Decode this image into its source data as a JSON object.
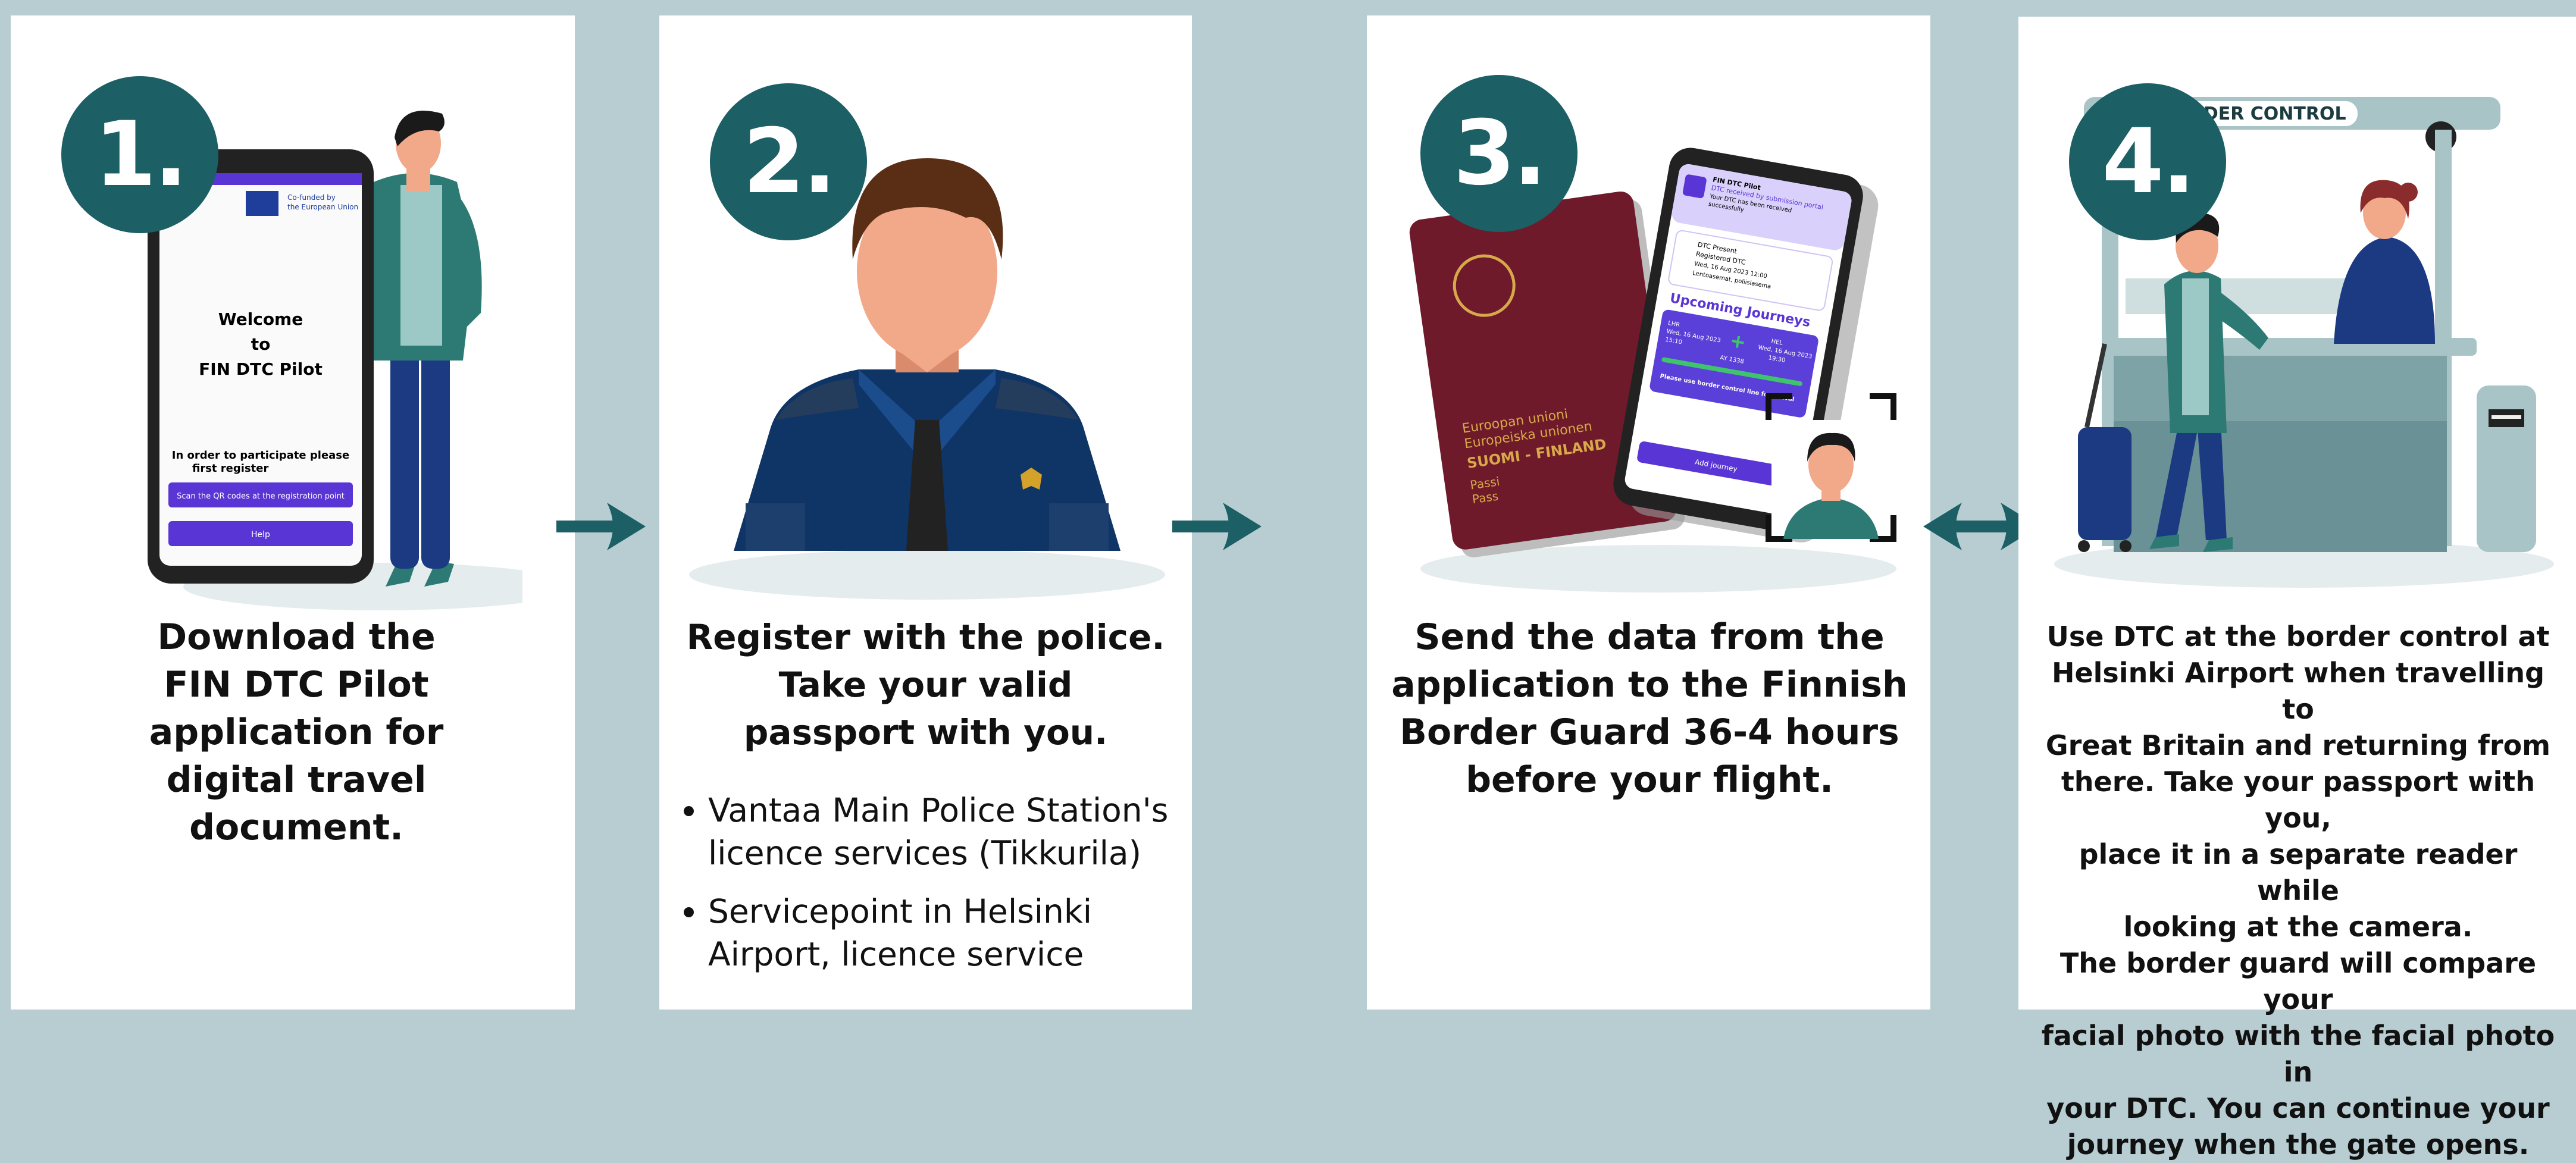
{
  "steps": [
    {
      "number": "1.",
      "caption": [
        "Download the",
        "FIN DTC Pilot",
        "application for",
        "digital travel",
        "document."
      ],
      "phone": {
        "cofunded": [
          "Co-funded by",
          "the European Union"
        ],
        "welcome": [
          "Welcome",
          "to",
          "FIN DTC Pilot"
        ],
        "register": [
          "In order to participate please",
          "first register"
        ],
        "button1": "Scan the QR codes at the registration point",
        "button2": "Help"
      }
    },
    {
      "number": "2.",
      "caption": [
        "Register with the police.",
        "Take your valid",
        "passport with you."
      ],
      "bullets": [
        [
          "Vantaa Main Police Station's",
          "licence services (Tikkurila)"
        ],
        [
          "Servicepoint in Helsinki",
          "Airport, licence service"
        ]
      ]
    },
    {
      "number": "3.",
      "caption": [
        "Send the data from the",
        "application to the Finnish",
        "Border Guard 36-4 hours",
        "before your flight."
      ],
      "passport": [
        "Euroopan unioni",
        "Europeiska unionen",
        "SUOMI - FINLAND",
        "Passi",
        "Pass"
      ],
      "phone": {
        "header": [
          "FIN DTC Pilot",
          "DTC received by submission portal",
          "Your DTC has been received",
          "successfully"
        ],
        "status": [
          "DTC Present",
          "Registered DTC",
          "Wed, 16 Aug 2023 12:00",
          "Lentoasemat, poliisiasema"
        ],
        "upcoming": "Upcoming Journeys",
        "journey": [
          "LHR",
          "Wed, 16 Aug 2023",
          "15:10",
          "HEL",
          "Wed, 16 Aug 2023",
          "19:30",
          "AY 1338"
        ],
        "notice": "Please use border control line for arrival",
        "add": "Add journey"
      }
    },
    {
      "number": "4.",
      "sign": "BORDER CONTROL",
      "caption": [
        "Use DTC at the border control at",
        "Helsinki Airport when travelling to",
        "Great Britain and returning from",
        "there. Take your passport with you,",
        "place it in a separate reader while",
        "looking at the camera.",
        "The border guard will compare your",
        "facial photo with the facial photo in",
        "your DTC. You can continue your",
        "journey when the gate opens."
      ]
    }
  ],
  "colors": {
    "teal": "#1c5f64",
    "background": "#b7cdd2",
    "purple": "#5a35d6",
    "navy": "#10306b"
  }
}
